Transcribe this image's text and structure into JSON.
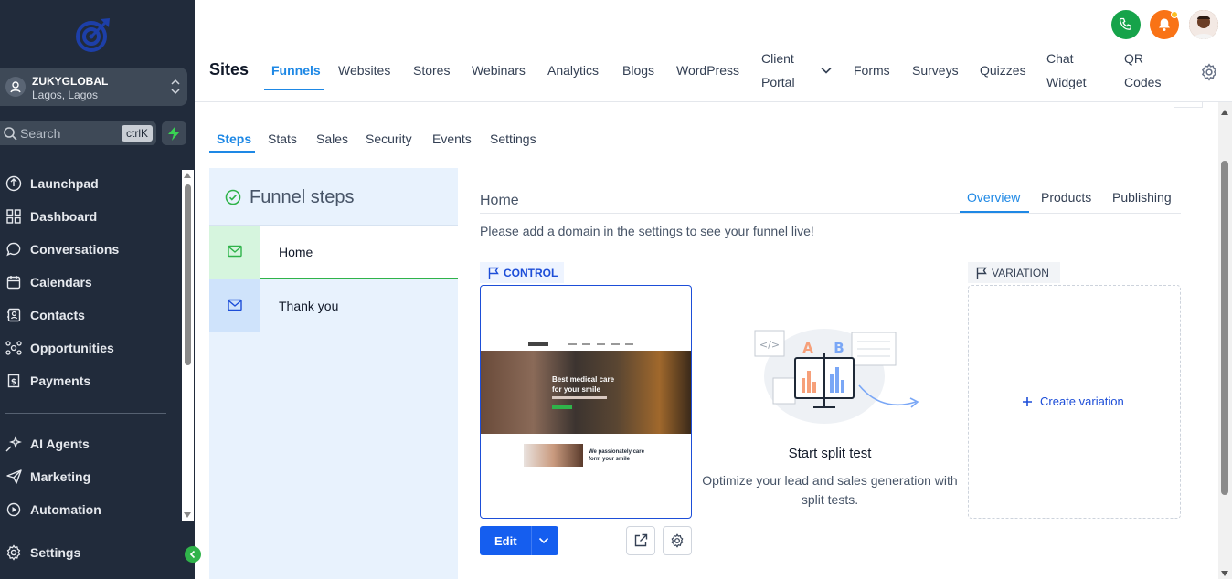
{
  "sidebar": {
    "account": {
      "name": "ZUKYGLOBAL",
      "location": "Lagos, Lagos"
    },
    "search": {
      "placeholder": "Search",
      "shortcut": "ctrlK"
    },
    "items": [
      {
        "label": "Launchpad",
        "icon": "rocket-icon"
      },
      {
        "label": "Dashboard",
        "icon": "dashboard-icon"
      },
      {
        "label": "Conversations",
        "icon": "chat-icon"
      },
      {
        "label": "Calendars",
        "icon": "calendar-icon"
      },
      {
        "label": "Contacts",
        "icon": "contacts-icon"
      },
      {
        "label": "Opportunities",
        "icon": "opportunities-icon"
      },
      {
        "label": "Payments",
        "icon": "payments-icon"
      },
      {
        "label": "AI Agents",
        "icon": "sparkle-icon"
      },
      {
        "label": "Marketing",
        "icon": "send-icon"
      },
      {
        "label": "Automation",
        "icon": "automation-icon"
      },
      {
        "label": "Settings",
        "icon": "gear-icon"
      }
    ],
    "accent": "#2fb34a"
  },
  "topbar": {
    "title": "Sites",
    "nav": [
      {
        "label": "Funnels",
        "active": true
      },
      {
        "label": "Websites"
      },
      {
        "label": "Stores"
      },
      {
        "label": "Webinars"
      },
      {
        "label": "Analytics"
      },
      {
        "label": "Blogs"
      },
      {
        "label": "WordPress"
      },
      {
        "label": "Client Portal"
      },
      {
        "label": "Forms"
      },
      {
        "label": "Surveys"
      },
      {
        "label": "Quizzes"
      },
      {
        "label": "Chat Widget"
      },
      {
        "label": "QR Codes"
      }
    ]
  },
  "subtabs": [
    "Steps",
    "Stats",
    "Sales",
    "Security",
    "Events",
    "Settings"
  ],
  "steps_panel": {
    "title": "Funnel steps",
    "steps": [
      {
        "label": "Home",
        "selected": true
      },
      {
        "label": "Thank you"
      }
    ]
  },
  "detail": {
    "title": "Home",
    "tabs": [
      "Overview",
      "Products",
      "Publishing"
    ],
    "notice": "Please add a domain in the settings to see your funnel live!",
    "control_label": "CONTROL",
    "variation_label": "VARIATION",
    "preview": {
      "hero_heading": "Best medical care for your smile",
      "section_heading": "We passionately care form your smile"
    },
    "edit_label": "Edit",
    "split_test": {
      "title": "Start split test",
      "description": "Optimize your lead and sales generation with split tests.",
      "a_label": "A",
      "b_label": "B"
    },
    "create_variation": "Create variation"
  },
  "colors": {
    "primary": "#155eef",
    "link": "#1e88e5",
    "sidebar_bg": "#212b3b"
  }
}
